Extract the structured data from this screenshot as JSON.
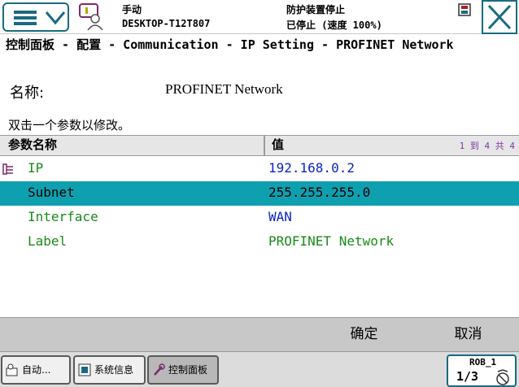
{
  "topbar": {
    "mode": "手动",
    "host": "DESKTOP-T12T807",
    "state": "防护装置停止",
    "speed": "已停止 (速度 100%)"
  },
  "breadcrumb": "控制面板 - 配置 - Communication - IP Setting - PROFINET Network",
  "name": {
    "label": "名称:",
    "value": "PROFINET Network"
  },
  "hint": "双击一个参数以修改。",
  "table": {
    "headers": {
      "name": "参数名称",
      "value": "值"
    },
    "pager": "1 到 4 共 4",
    "rows": [
      {
        "name": "IP",
        "value": "192.168.0.2"
      },
      {
        "name": "Subnet",
        "value": "255.255.255.0"
      },
      {
        "name": "Interface",
        "value": "WAN"
      },
      {
        "name": "Label",
        "value": "PROFINET Network"
      }
    ],
    "selected_row": "Subnet"
  },
  "actions": {
    "ok": "确定",
    "cancel": "取消"
  },
  "taskbar": {
    "items": [
      {
        "label": "自动...",
        "icon": "auto-window-icon"
      },
      {
        "label": "系统信息",
        "icon": "system-info-icon"
      },
      {
        "label": "控制面板",
        "icon": "control-panel-icon"
      }
    ],
    "rob_label": "ROB_1",
    "rob_fraction": "1/3"
  },
  "colors": {
    "accent": "#1a6b80",
    "selected_row": "#0fa0b0",
    "name_text": "#1a8a1a",
    "value_blue": "#0a24c8",
    "value_green": "#1a8a1a",
    "pager": "#7a3aa8"
  }
}
